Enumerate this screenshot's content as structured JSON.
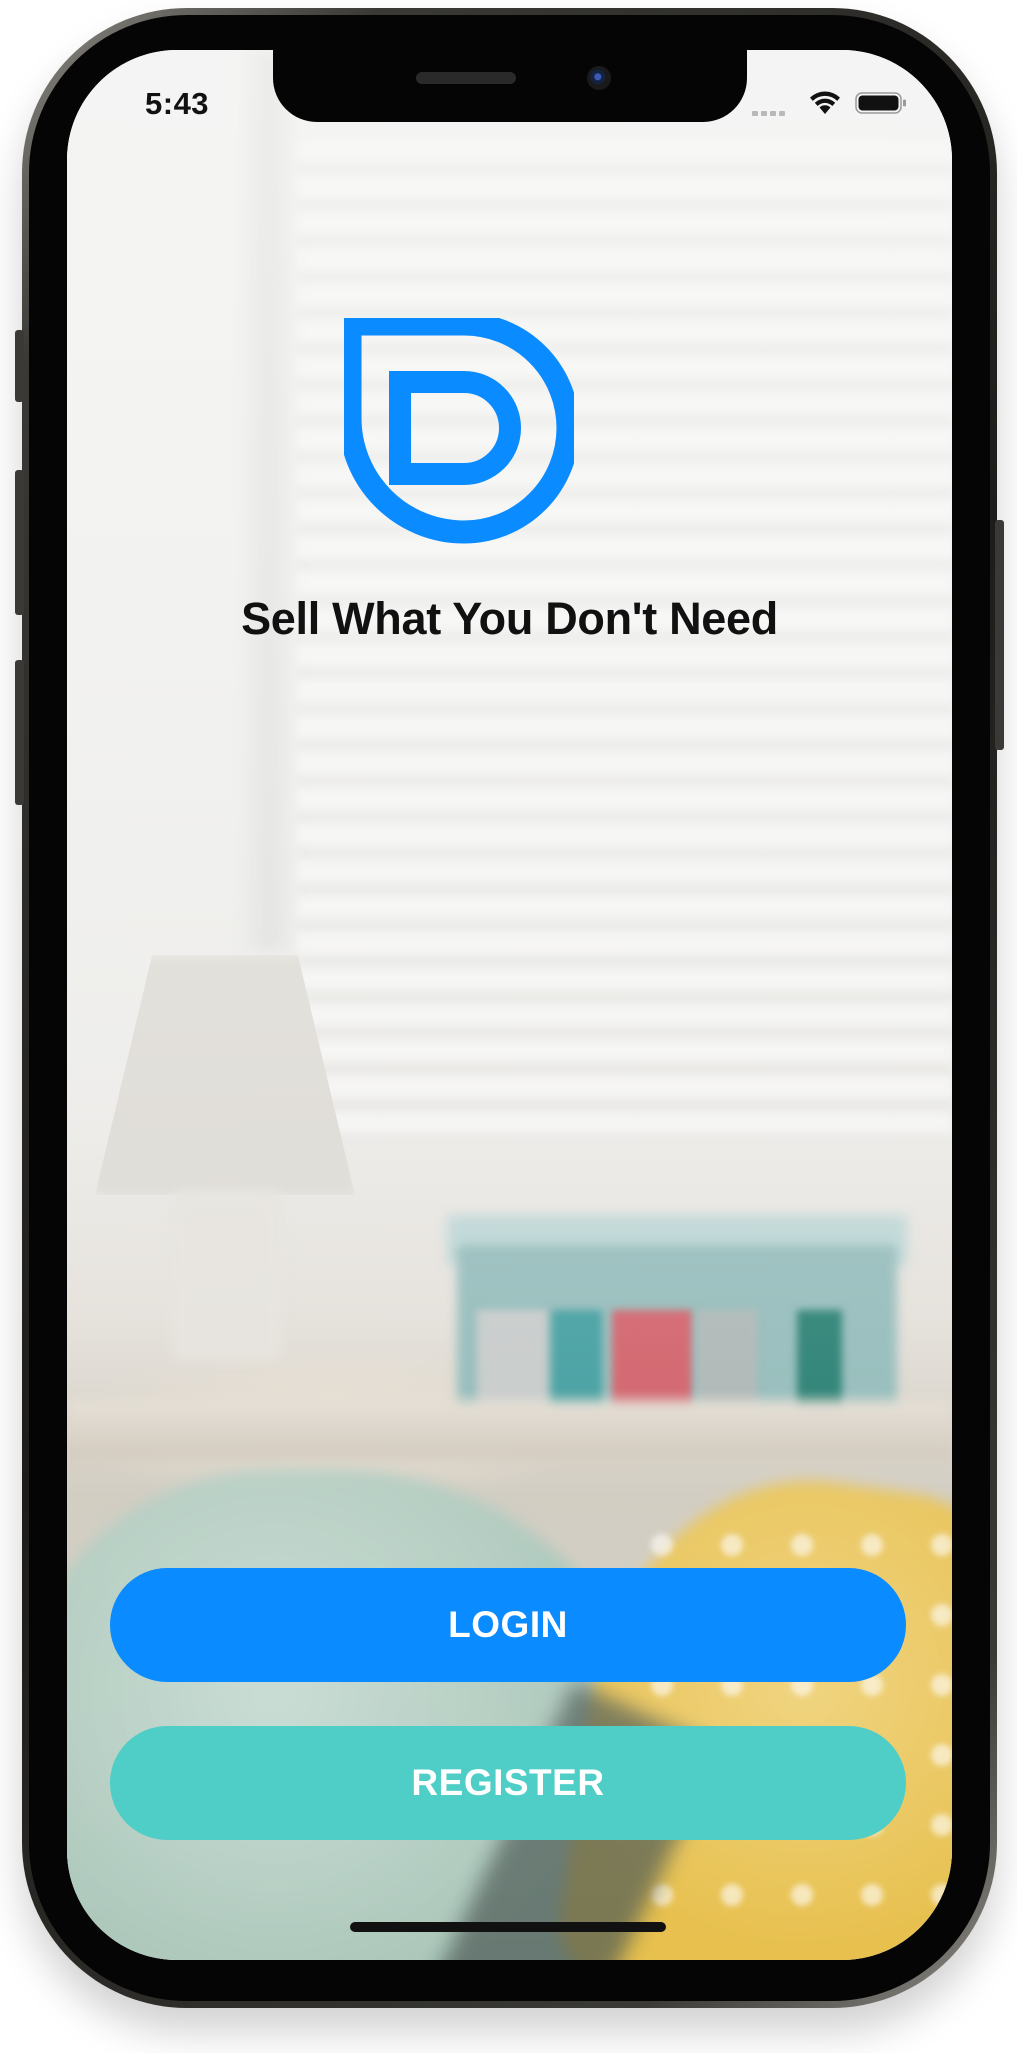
{
  "status_bar": {
    "time": "5:43"
  },
  "brand": {
    "logo_icon": "d-logo-icon",
    "tagline": "Sell What You Don't Need",
    "accent_color": "#0a8bff"
  },
  "actions": {
    "login_label": "LOGIN",
    "register_label": "REGISTER",
    "login_color": "#0a8bff",
    "register_color": "#4ecec6"
  }
}
